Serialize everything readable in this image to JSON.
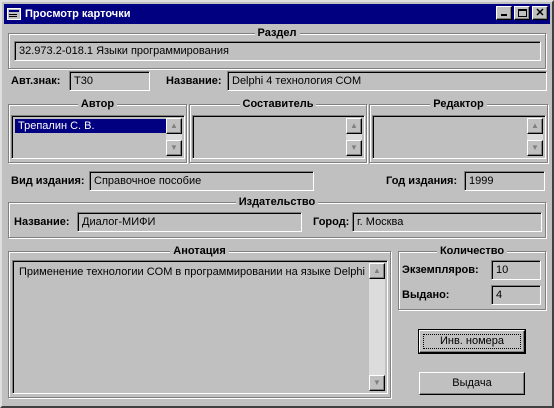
{
  "window": {
    "title": "Просмотр карточки"
  },
  "section": {
    "title": "Раздел",
    "value": "32.973.2-018.1  Языки программирования"
  },
  "author_sign": {
    "label": "Авт.знак:",
    "value": "Т30"
  },
  "book_title": {
    "label": "Название:",
    "value": "Delphi 4 технология COM"
  },
  "author": {
    "title": "Автор",
    "items": [
      "Трепалин С. В."
    ]
  },
  "compiler": {
    "title": "Составитель",
    "items": []
  },
  "editor": {
    "title": "Редактор",
    "items": []
  },
  "edition_type": {
    "label": "Вид издания:",
    "value": "Справочное пособие"
  },
  "edition_year": {
    "label": "Год издания:",
    "value": "1999"
  },
  "publisher": {
    "title": "Издательство",
    "name_label": "Название:",
    "name_value": "Диалог-МИФИ",
    "city_label": "Город:",
    "city_value": "г. Москва"
  },
  "annotation": {
    "title": "Анотация",
    "text": "Применение технологии COM в программировании на языке Delphi"
  },
  "quantity": {
    "title": "Количество",
    "copies_label": "Экземпляров:",
    "copies_value": "10",
    "issued_label": "Выдано:",
    "issued_value": "4"
  },
  "buttons": {
    "inventory": "Инв. номера",
    "issue": "Выдача"
  },
  "icons": {
    "minimize": "minimize-icon",
    "maximize": "maximize-icon",
    "close": "close-icon"
  },
  "colors": {
    "titlebar": "#000080",
    "face": "#c0c0c0",
    "selection": "#000080"
  }
}
